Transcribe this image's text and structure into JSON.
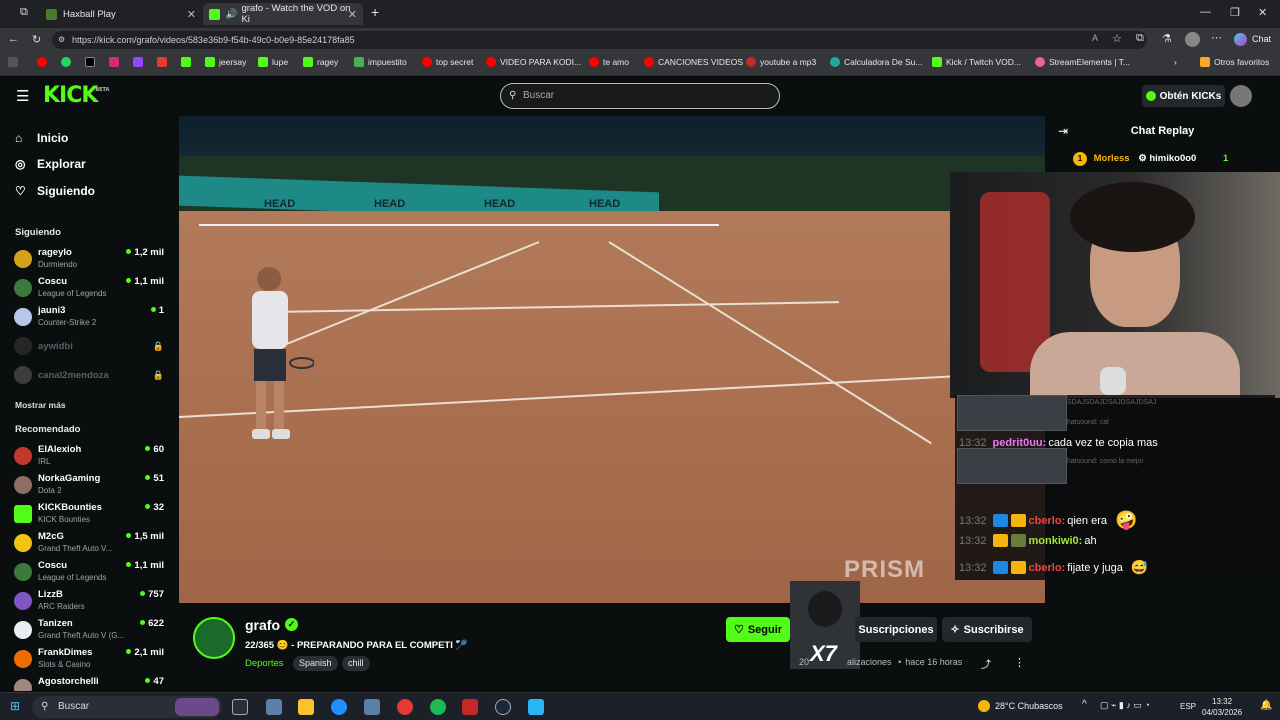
{
  "browser": {
    "tabs": [
      {
        "title": "Haxball Play"
      },
      {
        "title": "grafo - Watch the VOD on Ki"
      }
    ],
    "url": "https://kick.com/grafo/videos/583e36b9-f54b-49c0-b0e9-85e24178fa85",
    "chat_button": "Chat",
    "bookmarks": [
      "jeersay",
      "lupe",
      "ragey",
      "impuestito",
      "top secret",
      "VIDEO PARA KODI...",
      "te amo",
      "CANCIONES VIDEOS",
      "youtube a mp3",
      "Calculadora De Su...",
      "Kick / Twitch VOD...",
      "StreamElements | T..."
    ],
    "other_favorites": "Otros favoritos"
  },
  "header": {
    "logo": "KICK",
    "logo_beta": "BETA",
    "search_placeholder": "Buscar",
    "get_kicks": "Obtén KICKs"
  },
  "sidebar": {
    "nav": [
      {
        "label": "Inicio"
      },
      {
        "label": "Explorar"
      },
      {
        "label": "Siguiendo"
      }
    ],
    "following_title": "Siguiendo",
    "following": [
      {
        "name": "rageylo",
        "game": "Durmiendo",
        "viewers": "1,2 mil"
      },
      {
        "name": "Coscu",
        "game": "League of Legends",
        "viewers": "1,1 mil"
      },
      {
        "name": "jauni3",
        "game": "Counter-Strike 2",
        "viewers": "1"
      },
      {
        "name": "aywidbi",
        "game": "",
        "viewers": "🔒"
      },
      {
        "name": "canal2mendoza",
        "game": "",
        "viewers": "🔒"
      }
    ],
    "show_more": "Mostrar más",
    "recommended_title": "Recomendado",
    "recommended": [
      {
        "name": "ElAlexioh",
        "game": "IRL",
        "viewers": "60"
      },
      {
        "name": "NorkaGaming",
        "game": "Dota 2",
        "viewers": "51"
      },
      {
        "name": "KICKBounties",
        "game": "KICK Bounties",
        "viewers": "32"
      },
      {
        "name": "M2cG",
        "game": "Grand Theft Auto V...",
        "viewers": "1,5 mil"
      },
      {
        "name": "Coscu",
        "game": "League of Legends",
        "viewers": "1,1 mil"
      },
      {
        "name": "LizzB",
        "game": "ARC Raiders",
        "viewers": "757"
      },
      {
        "name": "Tanizen",
        "game": "Grand Theft Auto V (G...",
        "viewers": "622"
      },
      {
        "name": "FrankDimes",
        "game": "Slots & Casino",
        "viewers": "2,1 mil"
      },
      {
        "name": "Agostorchelli",
        "game": "",
        "viewers": "47"
      }
    ]
  },
  "video": {
    "watermark": "PRISM",
    "head_brand": "HEAD"
  },
  "chat": {
    "title": "Chat Replay",
    "pinned_user1": "Morless",
    "pinned_user2": "himiko0o0",
    "pinned_count": "1",
    "faint_lines": [
      "SDAJSDAJDSAJDSAJDSAJ",
      "hatsound: cal",
      "hatsound: como la mejor"
    ],
    "messages": [
      {
        "time": "13:32",
        "user": "pedrit0uu:",
        "text": "cada vez te copia mas",
        "color": "#e879f9"
      },
      {
        "time": "13:32",
        "user": "cberlo:",
        "text": "qien era",
        "color": "#ef4444"
      },
      {
        "time": "13:32",
        "user": "monkiwi0:",
        "text": "ah",
        "color": "#a3e635"
      },
      {
        "time": "13:32",
        "user": "cberlo:",
        "text": "fijate y juga",
        "color": "#ef4444"
      }
    ]
  },
  "stream": {
    "name": "grafo",
    "title": "22/365 😊 - PREPARANDO PARA EL COMPETI 🏸",
    "category": "Deportes",
    "tags": [
      "Spanish",
      "chill"
    ],
    "follow": "Seguir",
    "subscriptions": "Suscripciones",
    "subscribe": "Suscribirse",
    "views_prefix": "20",
    "views_suffix": "alizaciones",
    "time_ago": "hace 16 horas",
    "mini_cam_label": "X7"
  },
  "taskbar": {
    "search": "Buscar",
    "weather": "28°C  Chubascos",
    "lang": "ESP",
    "time": "13:32",
    "date": "04/03/2026"
  },
  "colors": {
    "kick_green": "#53fc18",
    "background": "#0b0e0f"
  }
}
